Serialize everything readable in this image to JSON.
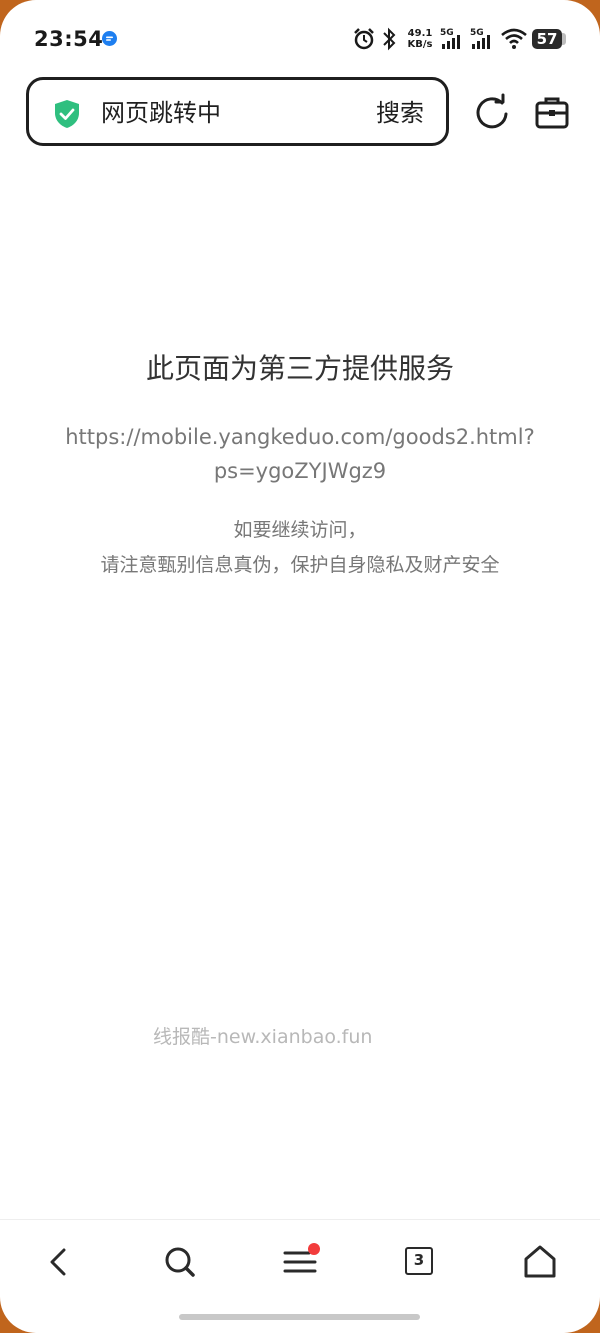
{
  "status_bar": {
    "time": "23:54",
    "net_speed_value": "49.1",
    "net_speed_unit": "KB/s",
    "signal1_label": "5G",
    "signal2_label": "5G",
    "battery": "57"
  },
  "address_bar": {
    "title": "网页跳转中",
    "search_label": "搜索"
  },
  "content": {
    "title": "此页面为第三方提供服务",
    "url": "https://mobile.yangkeduo.com/goods2.html?ps=ygoZYJWgz9",
    "notice_line1": "如要继续访问，",
    "notice_line2": "请注意甄别信息真伪，保护自身隐私及财产安全"
  },
  "watermark": "线报酷-new.xianbao.fun",
  "bottom_nav": {
    "tab_count": "3"
  },
  "colors": {
    "shield": "#2fbf7f",
    "badge": "#f23c3c",
    "app_dot": "#1e7ff0"
  }
}
